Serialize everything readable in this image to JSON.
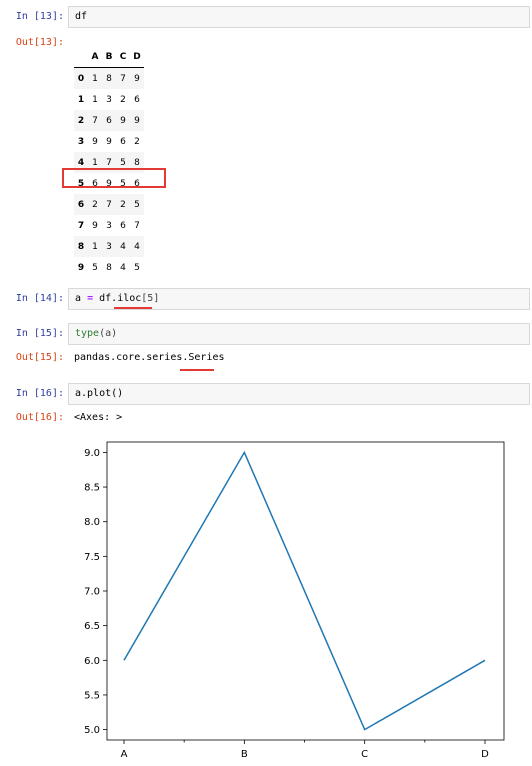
{
  "cells": {
    "c13": {
      "in_prompt": "In [13]:",
      "code": "df",
      "out_prompt": "Out[13]:"
    },
    "c14": {
      "in_prompt": "In [14]:",
      "code_var": "a",
      "code_eq": "=",
      "code_obj": "df.",
      "code_method": "iloc",
      "code_arg": "[5]"
    },
    "c15": {
      "in_prompt": "In [15]:",
      "code_fn": "type",
      "code_arg": "(a)",
      "out_prompt": "Out[15]:",
      "out_prefix": "pandas.core.series.",
      "out_cls": "Series"
    },
    "c16": {
      "in_prompt": "In [16]:",
      "code": "a.plot()",
      "out_prompt": "Out[16]:",
      "out_text": "<Axes: >"
    }
  },
  "dataframe": {
    "columns": [
      "A",
      "B",
      "C",
      "D"
    ],
    "index": [
      "0",
      "1",
      "2",
      "3",
      "4",
      "5",
      "6",
      "7",
      "8",
      "9"
    ],
    "rows": [
      [
        "1",
        "8",
        "7",
        "9"
      ],
      [
        "1",
        "3",
        "2",
        "6"
      ],
      [
        "7",
        "6",
        "9",
        "9"
      ],
      [
        "9",
        "9",
        "6",
        "2"
      ],
      [
        "1",
        "7",
        "5",
        "8"
      ],
      [
        "6",
        "9",
        "5",
        "6"
      ],
      [
        "2",
        "7",
        "2",
        "5"
      ],
      [
        "9",
        "3",
        "6",
        "7"
      ],
      [
        "1",
        "3",
        "4",
        "4"
      ],
      [
        "5",
        "8",
        "4",
        "5"
      ]
    ],
    "highlight_color": "#e53935"
  },
  "chart_data": {
    "type": "line",
    "categories": [
      "A",
      "B",
      "C",
      "D"
    ],
    "values": [
      6,
      9,
      5,
      6
    ],
    "ylim": [
      4.85,
      9.15
    ],
    "yticks": [
      "5.0",
      "5.5",
      "6.0",
      "6.5",
      "7.0",
      "7.5",
      "8.0",
      "8.5",
      "9.0"
    ],
    "line_color": "#1f77b4",
    "grid": false
  }
}
